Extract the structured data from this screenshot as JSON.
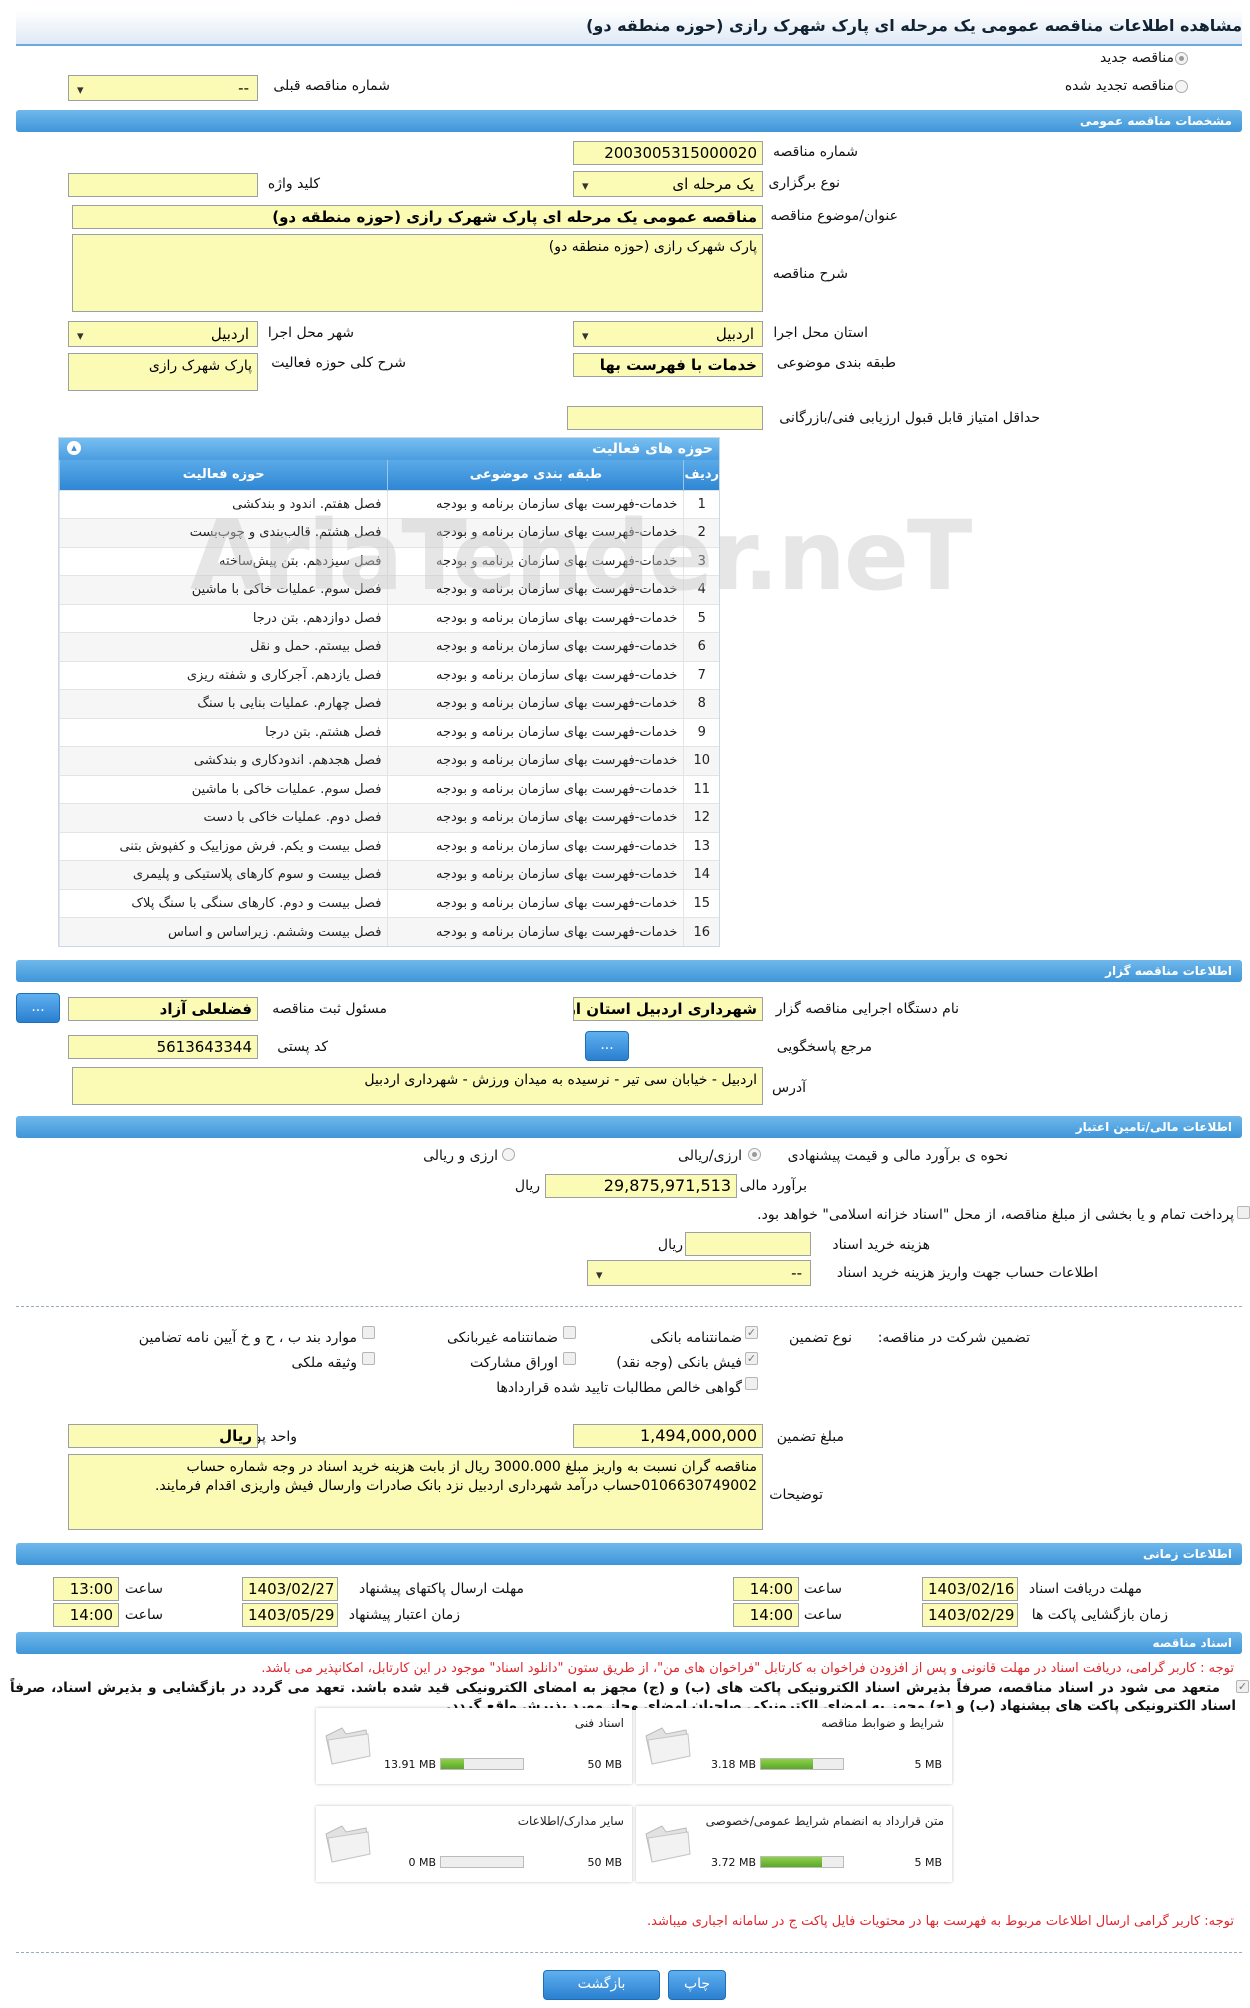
{
  "title": "مشاهده اطلاعات مناقصه عمومی یک مرحله ای پارک شهرک رازی (حوزه منطقه دو)",
  "top": {
    "new_tender": "مناقصه جدید",
    "renewed_tender": "مناقصه تجدید شده",
    "prev_tender_label": "شماره مناقصه قبلی",
    "prev_tender_value": "--"
  },
  "general": {
    "header": "مشخصات مناقصه عمومی",
    "number_label": "شماره مناقصه",
    "number": "2003005315000020",
    "type_label": "نوع برگزاری",
    "type": "یک مرحله ای",
    "keyword_label": "کلید واژه",
    "keyword": "",
    "subject_label": "عنوان/موضوع مناقصه",
    "subject": "مناقصه عمومی یک مرحله ای پارک شهرک رازی (حوزه منطقه دو)",
    "desc_label": "شرح مناقصه",
    "desc": "پارک شهرک رازی (حوزه منطقه دو)",
    "province_label": "استان محل اجرا",
    "province": "اردبیل",
    "city_label": "شهر محل اجرا",
    "city": "اردبیل",
    "category_label": "طبقه بندی موضوعی",
    "category": "خدمات با فهرست بها",
    "activity_label": "شرح کلی حوزه فعالیت",
    "activity": "پارک شهرک رازی",
    "min_score_label": "حداقل امتیاز قابل قبول ارزیابی فنی/بازرگانی",
    "min_score": ""
  },
  "activities": {
    "title": "حوزه های فعالیت",
    "col_row": "ردیف",
    "col_category": "طبقه بندی موضوعی",
    "col_field": "حوزه فعالیت",
    "rows": [
      {
        "n": "1",
        "cat": "خدمات-فهرست بهای سازمان برنامه و بودجه",
        "field": "فصل هفتم. اندود و بندکشی"
      },
      {
        "n": "2",
        "cat": "خدمات-فهرست بهای سازمان برنامه و بودجه",
        "field": "فصل هشتم. قالب‌بندی و چوب‌بست"
      },
      {
        "n": "3",
        "cat": "خدمات-فهرست بهای سازمان برنامه و بودجه",
        "field": "فصل سیزدهم. بتن پیش‌ساخته"
      },
      {
        "n": "4",
        "cat": "خدمات-فهرست بهای سازمان برنامه و بودجه",
        "field": "فصل سوم. عملیات خاکی با ماشین"
      },
      {
        "n": "5",
        "cat": "خدمات-فهرست بهای سازمان برنامه و بودجه",
        "field": "فصل دوازدهم. بتن درجا"
      },
      {
        "n": "6",
        "cat": "خدمات-فهرست بهای سازمان برنامه و بودجه",
        "field": "فصل بیستم. حمل و نقل"
      },
      {
        "n": "7",
        "cat": "خدمات-فهرست بهای سازمان برنامه و بودجه",
        "field": "فصل یازدهم. آجرکاری و شفته ریزی"
      },
      {
        "n": "8",
        "cat": "خدمات-فهرست بهای سازمان برنامه و بودجه",
        "field": "فصل چهارم. عملیات بنایی با سنگ"
      },
      {
        "n": "9",
        "cat": "خدمات-فهرست بهای سازمان برنامه و بودجه",
        "field": "فصل هشتم. بتن درجا"
      },
      {
        "n": "10",
        "cat": "خدمات-فهرست بهای سازمان برنامه و بودجه",
        "field": "فصل هجدهم. اندودکاری و بندکشی"
      },
      {
        "n": "11",
        "cat": "خدمات-فهرست بهای سازمان برنامه و بودجه",
        "field": "فصل سوم. عملیات خاکی با ماشین"
      },
      {
        "n": "12",
        "cat": "خدمات-فهرست بهای سازمان برنامه و بودجه",
        "field": "فصل دوم. عملیات خاکی با دست"
      },
      {
        "n": "13",
        "cat": "خدمات-فهرست بهای سازمان برنامه و بودجه",
        "field": "فصل بیست و یکم. فرش موزاییک و کفپوش بتنی"
      },
      {
        "n": "14",
        "cat": "خدمات-فهرست بهای سازمان برنامه و بودجه",
        "field": "فصل بیست و سوم کارهای پلاستیکی و پلیمری"
      },
      {
        "n": "15",
        "cat": "خدمات-فهرست بهای سازمان برنامه و بودجه",
        "field": "فصل بیست و دوم. کارهای سنگی با سنگ پلاک"
      },
      {
        "n": "16",
        "cat": "خدمات-فهرست بهای سازمان برنامه و بودجه",
        "field": "فصل بیست وششم. زیراساس و اساس"
      }
    ]
  },
  "organizer": {
    "header": "اطلاعات مناقصه گزار",
    "org_label": "نام دستگاه اجرایی مناقصه گزار",
    "org": "شهرداری اردبیل استان اردبیل",
    "resp_label": "مسئول ثبت مناقصه",
    "resp": "فضلعلی آزاد",
    "ref_label": "مرجع پاسخگویی",
    "postal_label": "کد پستی",
    "postal": "5613643344",
    "addr_label": "آدرس",
    "addr": "اردبیل - خیابان سی تیر - نرسیده به میدان ورزش - شهرداری اردبیل",
    "more_btn": "..."
  },
  "finance": {
    "header": "اطلاعات مالی/تامین اعتبار",
    "method_label": "نحوه ی برآورد مالی و قیمت پیشنهادی",
    "opt1": "ارزی/ریالی",
    "opt2": "ارزی و ریالی",
    "estimate_label": "برآورد مالی",
    "estimate": "29,875,971,513",
    "rial": "ریال",
    "treasury": "پرداخت تمام و یا بخشی از مبلغ مناقصه، از محل \"اسناد خزانه اسلامی\" خواهد بود.",
    "doc_cost_label": "هزینه خرید اسناد",
    "doc_cost": "",
    "account_label": "اطلاعات حساب جهت واریز هزینه خرید اسناد",
    "account": "--",
    "guarantee_label": "تضمین شرکت در مناقصه:",
    "gtype_label": "نوع تضمین",
    "g_bank": "ضمانتنامه بانکی",
    "g_nonbank": "ضمانتنامه غیربانکی",
    "g_items": "موارد بند ب ، ح و خ آیین نامه تضامین",
    "g_receipt": "فیش بانکی (وجه نقد)",
    "g_bonds": "اوراق مشارکت",
    "g_property": "وثیقه ملکی",
    "g_claims": "گواهی خالص مطالبات تایید شده قراردادها",
    "amount_label": "مبلغ تضمین",
    "amount": "1,494,000,000",
    "currency_label": "واحد پول",
    "currency": "ریال",
    "notes_label": "توضیحات",
    "notes": "مناقصه گران نسبت به واریز مبلغ 3000.000 ریال از بابت هزینه خرید اسناد در وجه شماره حساب 0106630749002حساب درآمد شهرداری اردبیل نزد بانک صادرات وارسال فیش واریزی اقدام فرمایند."
  },
  "timing": {
    "header": "اطلاعات زمانی",
    "receive_label": "مهلت دریافت اسناد",
    "receive": "1403/02/16",
    "receive_time": "14:00",
    "send_label": "مهلت ارسال پاکتهای پیشنهاد",
    "send": "1403/02/27",
    "send_time": "13:00",
    "open_label": "زمان بازگشایی پاکت ها",
    "open": "1403/02/29",
    "open_time": "14:00",
    "valid_label": "زمان اعتبار پیشنهاد",
    "valid": "1403/05/29",
    "valid_time": "14:00",
    "time_label": "ساعت"
  },
  "docs": {
    "header": "اسناد مناقصه",
    "note1": "توجه : کاربر گرامی، دریافت اسناد در مهلت قانونی و پس از افزودن فراخوان به کارتابل \"فراخوان های من\"، از طریق ستون \"دانلود اسناد\" موجود در این کارتابل، امکانپذیر می باشد.",
    "commit": "متعهد می شود در اسناد مناقصه، صرفاً بذیرش اسناد الکترونیکی پاکت های (ب) و (ج) مجهز به امضای الکترونیکی قید شده باشد. تعهد می گردد در بازگشایی و بذیرش اسناد، صرفاً اسناد الکترونیکی پاکت های بیشنهاد (ب) و (ج) مجهز به امضای الکترونیکی صاحبان امضای مجاز مورد بذیرش واقع گردد.",
    "items": [
      {
        "title": "شرایط و ضوابط مناقصه",
        "current": "3.18 MB",
        "max": "5 MB",
        "fill": 0.64
      },
      {
        "title": "اسناد فنی",
        "current": "13.91 MB",
        "max": "50 MB",
        "fill": 0.28
      },
      {
        "title": "متن قرارداد به انضمام شرایط عمومی/خصوصی",
        "current": "3.72 MB",
        "max": "5 MB",
        "fill": 0.74
      },
      {
        "title": "سایر مدارک/اطلاعات",
        "current": "0 MB",
        "max": "50 MB",
        "fill": 0
      }
    ],
    "note2": "توجه: کاربر گرامی ارسال اطلاعات مربوط به فهرست بها در محتویات فایل پاکت ج در سامانه اجباری میباشد."
  },
  "buttons": {
    "print": "چاپ",
    "back": "بازگشت"
  },
  "watermark": "AriaTender.neT"
}
